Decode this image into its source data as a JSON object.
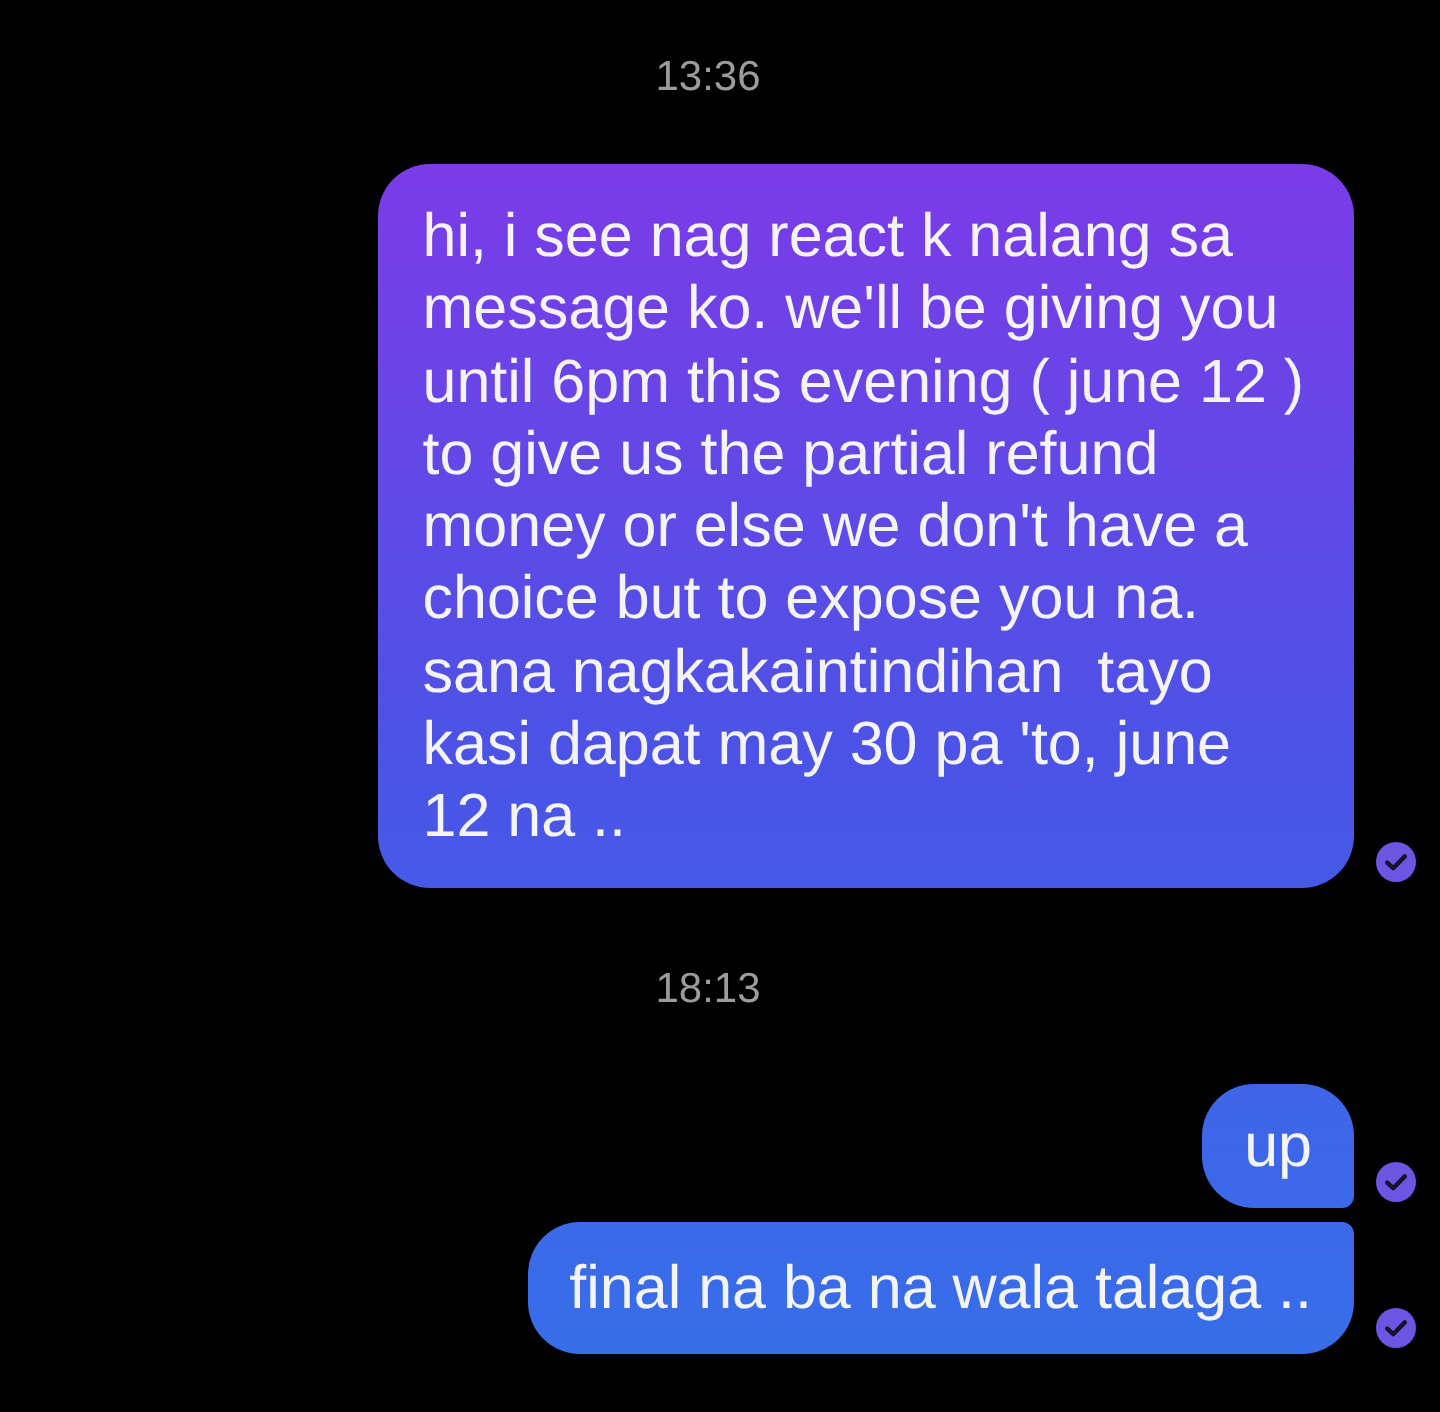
{
  "conversation": [
    {
      "kind": "timestamp",
      "text": "13:36"
    },
    {
      "kind": "message",
      "text": "hi, i see nag react k nalang sa message ko. we'll be giving you until 6pm this evening ( june 12 ) to give us the partial refund money or else we don't have a choice but to expose you na. sana nagkakaintindihan  tayo kasi dapat may 30 pa 'to, june 12 na ..",
      "joined_above": false,
      "joined_below": false,
      "delivered": true
    },
    {
      "kind": "timestamp",
      "text": "18:13"
    },
    {
      "kind": "message",
      "text": "up",
      "joined_above": false,
      "joined_below": true,
      "delivered": true
    },
    {
      "kind": "message",
      "text": "final na ba na wala talaga ..",
      "joined_above": true,
      "joined_below": false,
      "delivered": true
    }
  ]
}
